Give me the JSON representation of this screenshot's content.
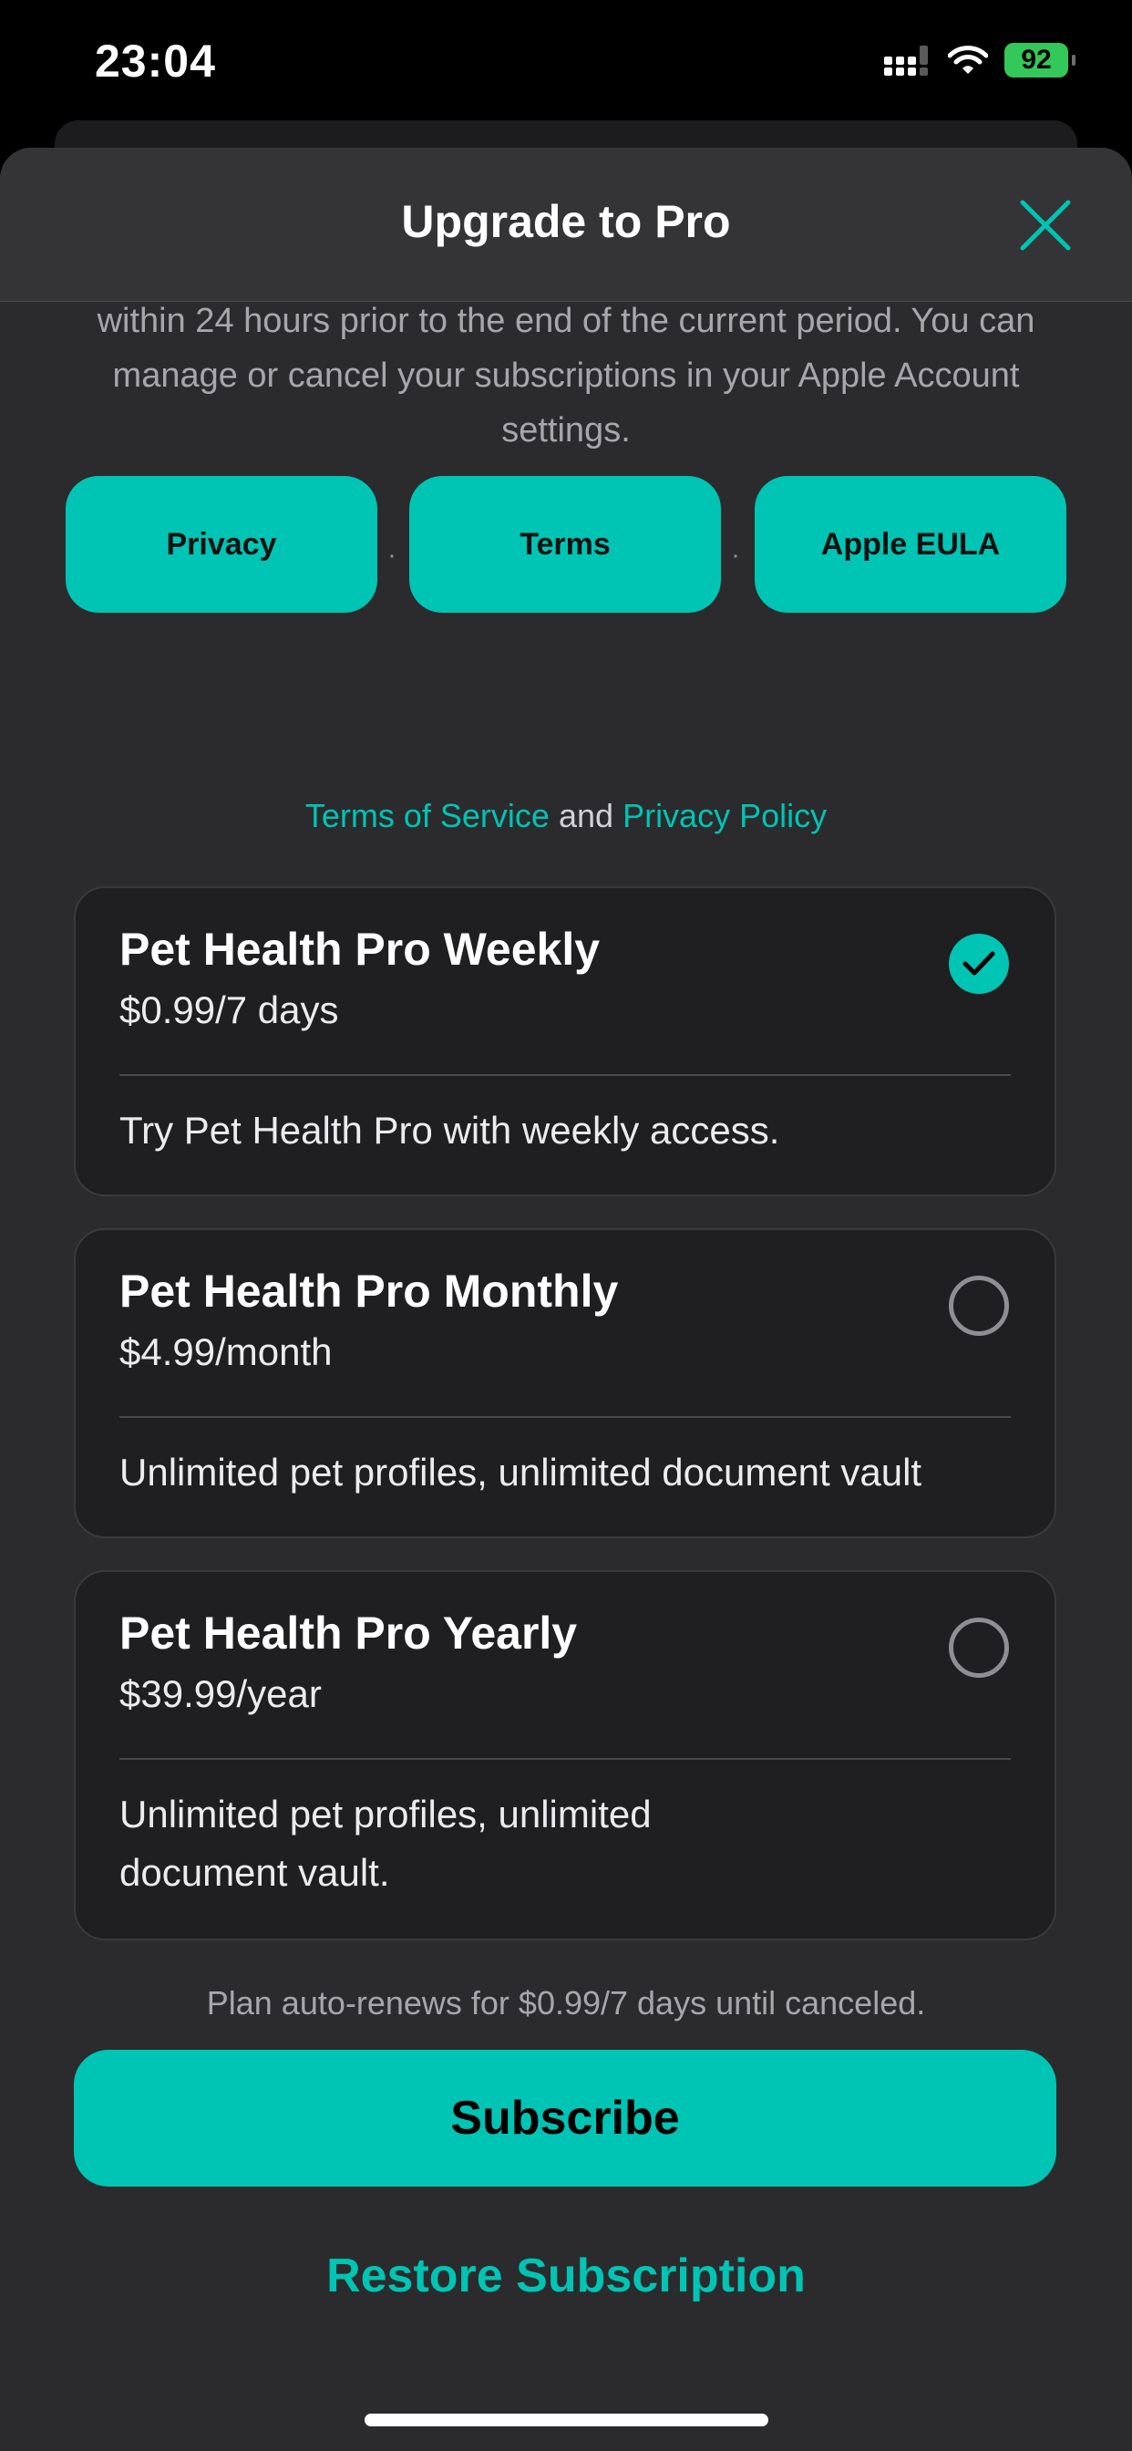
{
  "status_bar": {
    "time": "23:04",
    "battery": "92",
    "icons": [
      "signal-icon",
      "wifi-icon",
      "battery-icon"
    ]
  },
  "header": {
    "title": "Upgrade to Pro",
    "close_icon": "close-icon"
  },
  "legal": {
    "text": "within 24 hours prior to the end of the current period. You can manage or cancel your subscriptions in your Apple Account settings.",
    "links": [
      "Privacy",
      "Terms",
      "Apple EULA"
    ],
    "separator": "·"
  },
  "tos": {
    "terms_label": "Terms of Service",
    "and_label": "and",
    "privacy_label": "Privacy Policy"
  },
  "plans": [
    {
      "name": "Pet Health Pro Weekly",
      "price": "$0.99/7 days",
      "description": "Try Pet Health Pro with weekly access.",
      "selected": true
    },
    {
      "name": "Pet Health Pro Monthly",
      "price": "$4.99/month",
      "description": "Unlimited pet profiles, unlimited document vault",
      "selected": false
    },
    {
      "name": "Pet Health Pro Yearly",
      "price": "$39.99/year",
      "description": "Unlimited pet profiles, unlimited document vault.",
      "selected": false
    }
  ],
  "renew_note": "Plan auto-renews for $0.99/7 days until canceled.",
  "subscribe_label": "Subscribe",
  "restore_label": "Restore Subscription",
  "colors": {
    "accent": "#00c4b4",
    "sheet_background": "#2b2b2d",
    "card_background": "#1f1f21"
  }
}
